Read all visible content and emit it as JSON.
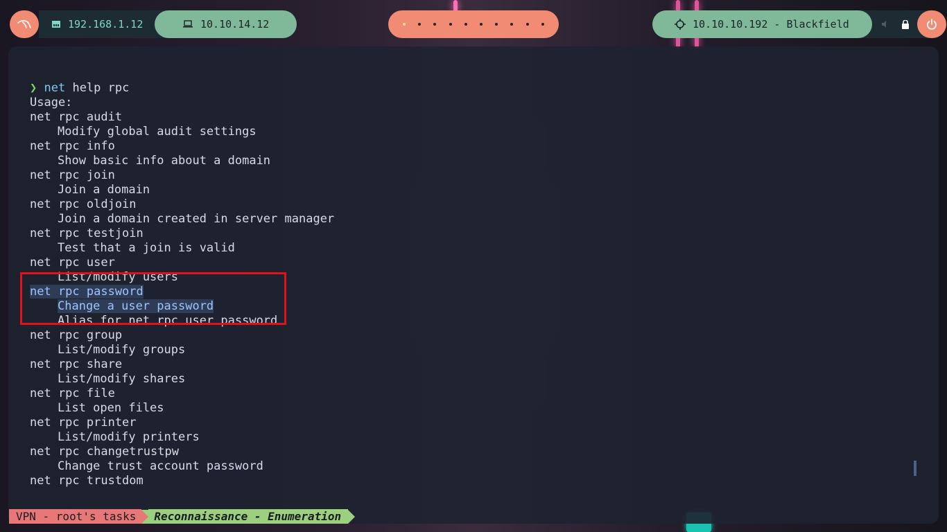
{
  "topbar": {
    "host_ip": "192.168.1.12",
    "vpn_ip": "10.10.14.12",
    "target": "10.10.10.192 - Blackfield",
    "workspaces": 10,
    "active_workspace": 1
  },
  "terminal": {
    "prompt_symbol": "❯",
    "prompt_cmd": "net",
    "prompt_args": " help rpc",
    "lines": [
      {
        "text": "Usage:",
        "indent": false
      },
      {
        "text": "net rpc audit",
        "indent": false
      },
      {
        "text": "Modify global audit settings",
        "indent": true
      },
      {
        "text": "net rpc info",
        "indent": false
      },
      {
        "text": "Show basic info about a domain",
        "indent": true
      },
      {
        "text": "net rpc join",
        "indent": false
      },
      {
        "text": "Join a domain",
        "indent": true
      },
      {
        "text": "net rpc oldjoin",
        "indent": false
      },
      {
        "text": "Join a domain created in server manager",
        "indent": true
      },
      {
        "text": "net rpc testjoin",
        "indent": false
      },
      {
        "text": "Test that a join is valid",
        "indent": true
      },
      {
        "text": "net rpc user",
        "indent": false
      },
      {
        "text": "List/modify users",
        "indent": true
      },
      {
        "text": "net rpc password",
        "indent": false,
        "selected": true
      },
      {
        "text": "Change a user password",
        "indent": true,
        "selected": true
      },
      {
        "text": "Alias for net rpc user password",
        "indent": true
      },
      {
        "text": "net rpc group",
        "indent": false
      },
      {
        "text": "List/modify groups",
        "indent": true
      },
      {
        "text": "net rpc share",
        "indent": false
      },
      {
        "text": "List/modify shares",
        "indent": true
      },
      {
        "text": "net rpc file",
        "indent": false
      },
      {
        "text": "List open files",
        "indent": true
      },
      {
        "text": "net rpc printer",
        "indent": false
      },
      {
        "text": "List/modify printers",
        "indent": true
      },
      {
        "text": "net rpc changetrustpw",
        "indent": false
      },
      {
        "text": "Change trust account password",
        "indent": true
      },
      {
        "text": "net rpc trustdom",
        "indent": false
      }
    ]
  },
  "tmux": {
    "session": "VPN - root's tasks",
    "window": "Reconnaissance - Enumeration"
  },
  "colors": {
    "accent_orange": "#f28b74",
    "accent_green": "#7fb99a",
    "highlight_red": "#e0121c",
    "prompt_green": "#7fd36a"
  }
}
